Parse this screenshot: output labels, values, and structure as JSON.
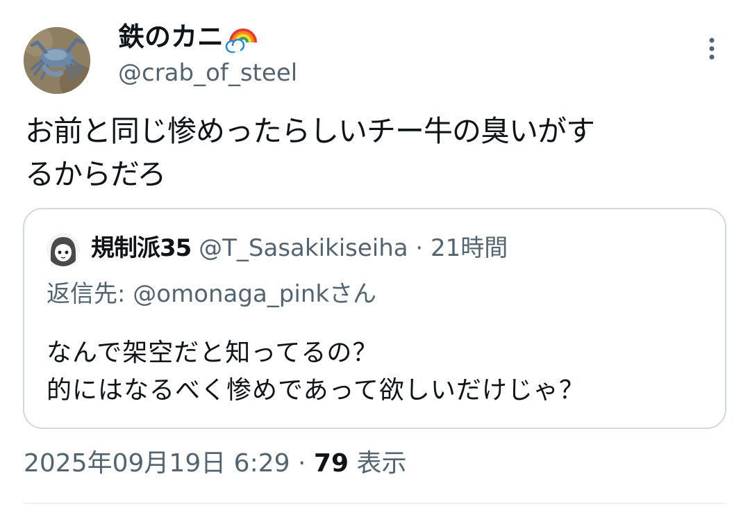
{
  "author": {
    "display_name": "鉄のカニ",
    "handle": "@crab_of_steel",
    "avatar_icon": "crab-avatar-icon",
    "badge_icon": "rainbow-emoji-icon"
  },
  "tweet": {
    "text": "お前と同じ惨めったらしいチー牛の臭いがす\nるからだろ",
    "timestamp": "2025年09月19日 6:29",
    "separator": "·",
    "views_count": "79",
    "views_label": "表示"
  },
  "quoted_tweet": {
    "display_name": "規制派35",
    "handle": "@T_Sasakikiseiha",
    "separator": "·",
    "time_ago": "21時間",
    "reply_to": "返信先: @omonaga_pinkさん",
    "text": "なんで架空だと知ってるの？\n的にはなるべく惨めであって欲しいだけじゃ？"
  },
  "colors": {
    "text_primary": "#0f1419",
    "text_secondary": "#536471",
    "border": "#cfd9de"
  }
}
